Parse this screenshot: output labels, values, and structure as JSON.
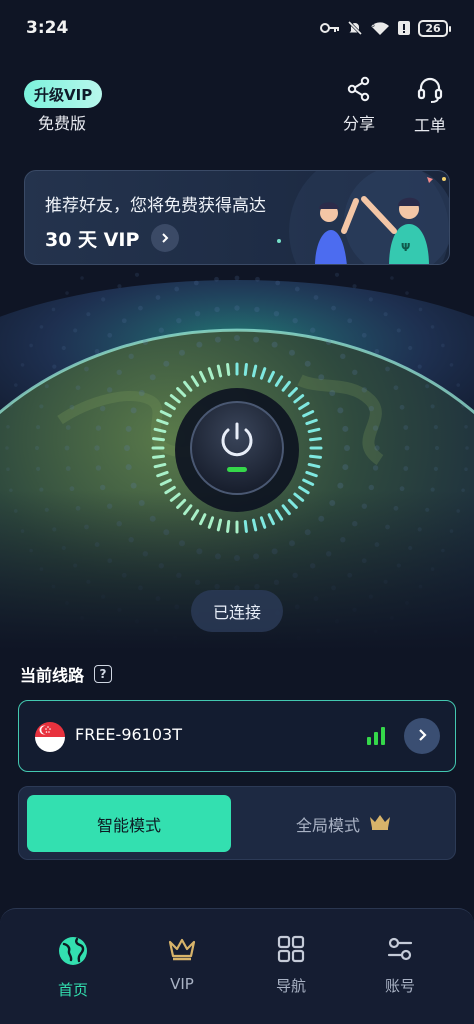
{
  "status_bar": {
    "time": "3:24",
    "battery": "26"
  },
  "header": {
    "vip_badge": "升级VIP",
    "plan": "免费版",
    "share_label": "分享",
    "ticket_label": "工单"
  },
  "banner": {
    "line1": "推荐好友，您将免费获得高达",
    "line2": "30 天 VIP"
  },
  "connection": {
    "status": "已连接"
  },
  "route": {
    "title": "当前线路",
    "help": "?",
    "server_name": "FREE-96103T",
    "signal_bars": 3
  },
  "modes": {
    "smart": "智能模式",
    "global": "全局模式",
    "active": "smart"
  },
  "tabs": [
    {
      "label": "首页",
      "icon": "globe-icon",
      "active": true
    },
    {
      "label": "VIP",
      "icon": "crown-icon",
      "active": false
    },
    {
      "label": "导航",
      "icon": "grid-icon",
      "active": false
    },
    {
      "label": "账号",
      "icon": "sliders-icon",
      "active": false
    }
  ],
  "colors": {
    "background": "#0f1525",
    "accent": "#33e0b0",
    "connected_indicator": "#35d84a",
    "vip_gold": "#d7b36a"
  }
}
